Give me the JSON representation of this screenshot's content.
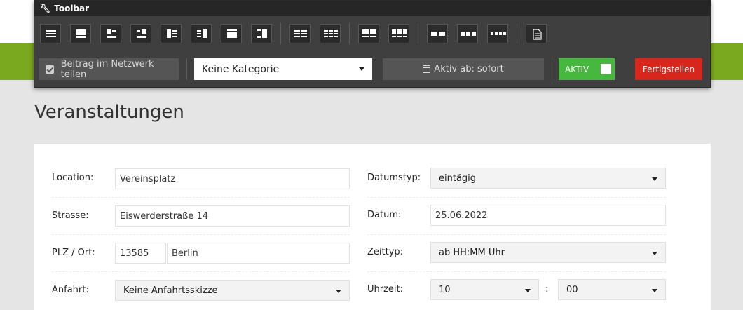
{
  "toolbar": {
    "title": "Toolbar",
    "layouts": [
      "layout-1",
      "layout-2",
      "layout-3",
      "layout-4",
      "layout-5",
      "layout-6",
      "layout-7",
      "layout-8",
      "layout-9",
      "layout-10",
      "layout-11",
      "layout-12",
      "layout-13",
      "layout-14",
      "layout-15",
      "page"
    ],
    "share_label": "Beitrag im Netzwerk teilen",
    "share_checked": true,
    "category_value": "Keine Kategorie",
    "active_from_label": "Aktiv ab: sofort",
    "toggle_label": "AKTIV",
    "finish_label": "Fertigstellen",
    "colors": {
      "toggle": "#47b83e",
      "finish": "#d7271c",
      "accent": "#7aa81e"
    }
  },
  "page": {
    "title": "Veranstaltungen"
  },
  "form": {
    "location": {
      "label": "Location:",
      "value": "Vereinsplatz"
    },
    "street": {
      "label": "Strasse:",
      "value": "Eiswerderstraße 14"
    },
    "zip_city": {
      "label": "PLZ / Ort:",
      "zip": "13585",
      "city": "Berlin"
    },
    "directions": {
      "label": "Anfahrt:",
      "value": "Keine Anfahrtsskizze"
    },
    "date_type": {
      "label": "Datumstyp:",
      "value": "eintägig"
    },
    "date": {
      "label": "Datum:",
      "value": "25.06.2022"
    },
    "time_type": {
      "label": "Zeittyp:",
      "value": "ab HH:MM Uhr"
    },
    "time": {
      "label": "Uhrzeit:",
      "hour": "10",
      "separator": ":",
      "minute": "00"
    }
  }
}
